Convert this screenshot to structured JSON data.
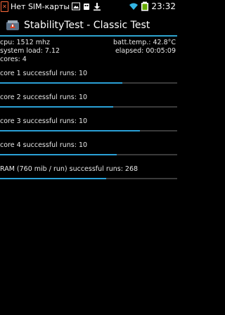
{
  "status_bar": {
    "carrier_text": "Нет SIM-карты",
    "time": "23:32"
  },
  "action_bar": {
    "title": "StabilityTest - Classic Test"
  },
  "stats": {
    "cpu": "cpu: 1512 mhz",
    "batt_temp": "batt.temp.: 42.8°C",
    "system_load": "system load: 7.12",
    "elapsed": "elapsed: 00:05:09",
    "cores": "cores: 4"
  },
  "rows": [
    {
      "label": "core 1 successful runs: 10",
      "progress": 0.69
    },
    {
      "label": "core 2 successful runs: 10",
      "progress": 0.64
    },
    {
      "label": "core 3 successful runs: 10",
      "progress": 0.79
    },
    {
      "label": "core 4 successful runs: 10",
      "progress": 0.66
    },
    {
      "label": "RAM (760 mib / run) successful runs: 268",
      "progress": 0.6
    }
  ],
  "colors": {
    "accent": "#33b5e5",
    "progress": "#2aa0d6",
    "track": "#3a3a3a"
  }
}
